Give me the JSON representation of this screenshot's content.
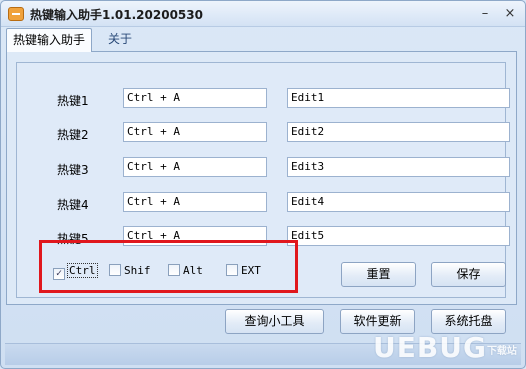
{
  "window": {
    "title": "热键输入助手1.01.20200530",
    "minimize_glyph": "–",
    "close_glyph": "×"
  },
  "tabs": [
    {
      "label": "热键输入助手",
      "active": true
    },
    {
      "label": "关于",
      "active": false
    }
  ],
  "hotkeys": [
    {
      "label": "热键1",
      "key": "Ctrl + A",
      "action": "Edit1"
    },
    {
      "label": "热键2",
      "key": "Ctrl + A",
      "action": "Edit2"
    },
    {
      "label": "热键3",
      "key": "Ctrl + A",
      "action": "Edit3"
    },
    {
      "label": "热键4",
      "key": "Ctrl + A",
      "action": "Edit4"
    },
    {
      "label": "热键5",
      "key": "Ctrl + A",
      "action": "Edit5"
    }
  ],
  "modifiers": [
    {
      "label": "Ctrl",
      "checked": true
    },
    {
      "label": "Shif",
      "checked": false
    },
    {
      "label": "Alt",
      "checked": false
    },
    {
      "label": "EXT",
      "checked": false
    }
  ],
  "buttons": {
    "reset": "重置",
    "save": "保存",
    "query_tool": "查询小工具",
    "update": "软件更新",
    "tray": "系统托盘"
  },
  "colors": {
    "highlight_box": "#e0171d"
  },
  "watermark": {
    "text": "UEBUG",
    "suffix": "下载站"
  }
}
